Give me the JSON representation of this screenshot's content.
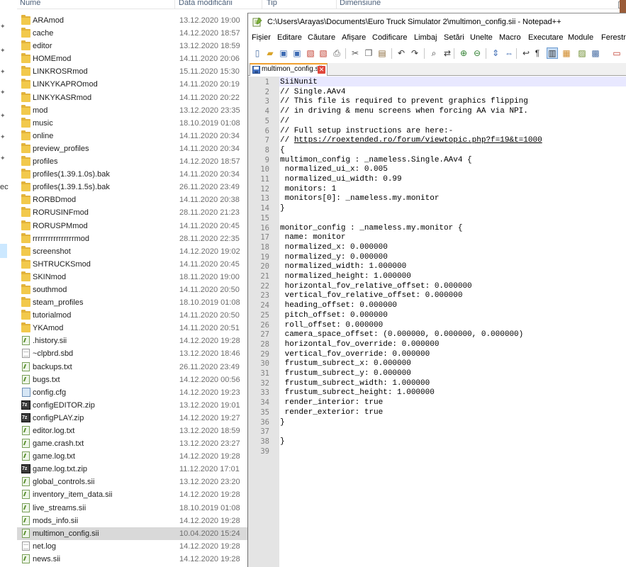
{
  "explorer": {
    "headers": {
      "name": "Nume",
      "date": "Data modificării",
      "type": "Tip",
      "size": "Dimensiune"
    },
    "nav_fragment": "ect",
    "files": [
      {
        "name": "ARAmod",
        "date": "13.12.2020 19:00",
        "kind": "folder"
      },
      {
        "name": "cache",
        "date": "14.12.2020 18:57",
        "kind": "folder"
      },
      {
        "name": "editor",
        "date": "13.12.2020 18:59",
        "kind": "folder"
      },
      {
        "name": "HOMEmod",
        "date": "14.11.2020 20:06",
        "kind": "folder"
      },
      {
        "name": "LINKROSRmod",
        "date": "15.11.2020 15:30",
        "kind": "folder"
      },
      {
        "name": "LINKYKAPROmod",
        "date": "14.11.2020 20:19",
        "kind": "folder"
      },
      {
        "name": "LINKYKASRmod",
        "date": "14.11.2020 20:22",
        "kind": "folder"
      },
      {
        "name": "mod",
        "date": "13.12.2020 23:35",
        "kind": "folder"
      },
      {
        "name": "music",
        "date": "18.10.2019 01:08",
        "kind": "folder"
      },
      {
        "name": "online",
        "date": "14.11.2020 20:34",
        "kind": "folder"
      },
      {
        "name": "preview_profiles",
        "date": "14.11.2020 20:34",
        "kind": "folder"
      },
      {
        "name": "profiles",
        "date": "14.12.2020 18:57",
        "kind": "folder"
      },
      {
        "name": "profiles(1.39.1.0s).bak",
        "date": "14.11.2020 20:34",
        "kind": "folder"
      },
      {
        "name": "profiles(1.39.1.5s).bak",
        "date": "26.11.2020 23:49",
        "kind": "folder"
      },
      {
        "name": "RORBDmod",
        "date": "14.11.2020 20:38",
        "kind": "folder"
      },
      {
        "name": "RORUSINFmod",
        "date": "28.11.2020 21:23",
        "kind": "folder"
      },
      {
        "name": "RORUSPMmod",
        "date": "14.11.2020 20:45",
        "kind": "folder"
      },
      {
        "name": "rrrrrrrrrrrrrrrrmod",
        "date": "28.11.2020 22:35",
        "kind": "folder"
      },
      {
        "name": "screenshot",
        "date": "14.12.2020 19:02",
        "kind": "folder"
      },
      {
        "name": "SHTRUCKSmod",
        "date": "14.11.2020 20:45",
        "kind": "folder"
      },
      {
        "name": "SKINmod",
        "date": "18.11.2020 19:00",
        "kind": "folder"
      },
      {
        "name": "southmod",
        "date": "14.11.2020 20:50",
        "kind": "folder"
      },
      {
        "name": "steam_profiles",
        "date": "18.10.2019 01:08",
        "kind": "folder"
      },
      {
        "name": "tutorialmod",
        "date": "14.11.2020 20:50",
        "kind": "folder"
      },
      {
        "name": "YKAmod",
        "date": "14.11.2020 20:51",
        "kind": "folder"
      },
      {
        "name": ".history.sii",
        "date": "14.12.2020 19:28",
        "kind": "sii"
      },
      {
        "name": "~clpbrd.sbd",
        "date": "13.12.2020 18:46",
        "kind": "file"
      },
      {
        "name": "backups.txt",
        "date": "26.11.2020 23:49",
        "kind": "sii"
      },
      {
        "name": "bugs.txt",
        "date": "14.12.2020 00:56",
        "kind": "sii"
      },
      {
        "name": "config.cfg",
        "date": "14.12.2020 19:23",
        "kind": "cfg"
      },
      {
        "name": "configEDITOR.zip",
        "date": "13.12.2020 19:01",
        "kind": "zip"
      },
      {
        "name": "configPLAY.zip",
        "date": "14.12.2020 19:27",
        "kind": "zip"
      },
      {
        "name": "editor.log.txt",
        "date": "13.12.2020 18:59",
        "kind": "sii"
      },
      {
        "name": "game.crash.txt",
        "date": "13.12.2020 23:27",
        "kind": "sii"
      },
      {
        "name": "game.log.txt",
        "date": "14.12.2020 19:28",
        "kind": "sii"
      },
      {
        "name": "game.log.txt.zip",
        "date": "11.12.2020 17:01",
        "kind": "zip"
      },
      {
        "name": "global_controls.sii",
        "date": "13.12.2020 23:20",
        "kind": "sii"
      },
      {
        "name": "inventory_item_data.sii",
        "date": "14.12.2020 19:28",
        "kind": "sii"
      },
      {
        "name": "live_streams.sii",
        "date": "18.10.2019 01:08",
        "kind": "sii"
      },
      {
        "name": "mods_info.sii",
        "date": "14.12.2020 19:28",
        "kind": "sii"
      },
      {
        "name": "multimon_config.sii",
        "date": "10.04.2020 15:24",
        "kind": "sii",
        "selected": true
      },
      {
        "name": "net.log",
        "date": "14.12.2020 19:28",
        "kind": "file"
      },
      {
        "name": "news.sii",
        "date": "14.12.2020 19:28",
        "kind": "sii"
      }
    ]
  },
  "notepad": {
    "title": "C:\\Users\\Arayas\\Documents\\Euro Truck Simulator 2\\multimon_config.sii - Notepad++",
    "menu": [
      "Fișier",
      "Editare",
      "Căutare",
      "Afișare",
      "Codificare",
      "Limbaj",
      "Setări",
      "Unelte",
      "Macro",
      "Executare",
      "Module",
      "Ferestre"
    ],
    "toolbar_icons": [
      "new-file-icon",
      "open-file-icon",
      "save-icon",
      "save-all-icon",
      "close-icon",
      "close-all-icon",
      "print-icon",
      "cut-icon",
      "copy-icon",
      "paste-icon",
      "undo-icon",
      "redo-icon",
      "find-icon",
      "replace-icon",
      "zoom-in-icon",
      "zoom-out-icon",
      "sync-vertical-icon",
      "sync-horizontal-icon",
      "word-wrap-icon",
      "show-all-chars-icon",
      "indent-guide-icon",
      "doc-map-icon",
      "function-list-icon",
      "folder-workspace-icon",
      "record-macro-icon"
    ],
    "tab": {
      "label": "multimon_config.sii"
    },
    "lines": [
      "SiiNunit",
      "// Single.AAv4",
      "// This file is required to prevent graphics flipping",
      "// in driving & menu screens when forcing AA via NPI.",
      "//",
      "// Full setup instructions are here:-",
      "// https://roextended.ro/forum/viewtopic.php?f=19&t=1000",
      "{",
      "multimon_config : _nameless.Single.AAv4 {",
      " normalized_ui_x: 0.005",
      " normalized_ui_width: 0.99",
      " monitors: 1",
      " monitors[0]: _nameless.my.monitor",
      "}",
      "",
      "monitor_config : _nameless.my.monitor {",
      " name: monitor",
      " normalized_x: 0.000000",
      " normalized_y: 0.000000",
      " normalized_width: 1.000000",
      " normalized_height: 1.000000",
      " horizontal_fov_relative_offset: 0.000000",
      " vertical_fov_relative_offset: 0.000000",
      " heading_offset: 0.000000",
      " pitch_offset: 0.000000",
      " roll_offset: 0.000000",
      " camera_space_offset: (0.000000, 0.000000, 0.000000)",
      " horizontal_fov_override: 0.000000",
      " vertical_fov_override: 0.000000",
      " frustum_subrect_x: 0.000000",
      " frustum_subrect_y: 0.000000",
      " frustum_subrect_width: 1.000000",
      " frustum_subrect_height: 1.000000",
      " render_interior: true",
      " render_exterior: true",
      "}",
      "",
      "}",
      ""
    ],
    "link_line_index": 6
  }
}
